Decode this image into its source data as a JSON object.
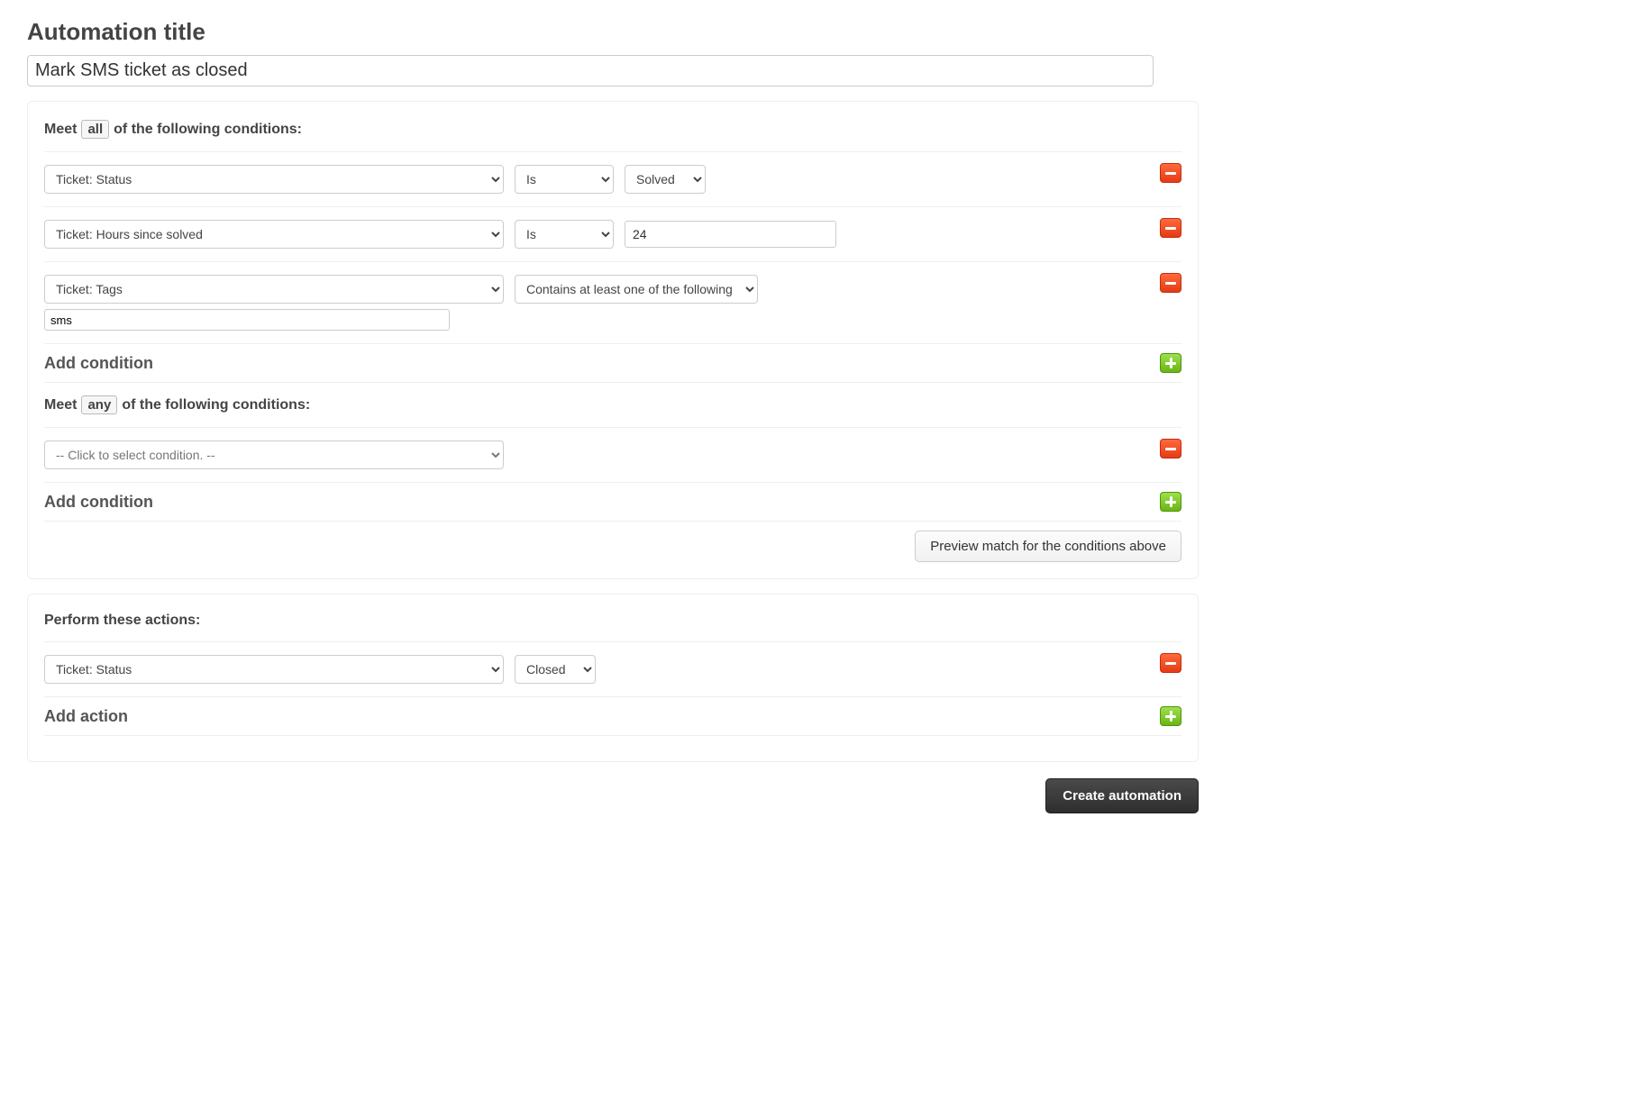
{
  "title_label": "Automation title",
  "title_value": "Mark SMS ticket as closed",
  "conditions": {
    "all": {
      "prefix": "Meet",
      "qualifier": "all",
      "suffix": "of the following conditions:",
      "rows": [
        {
          "field": "Ticket: Status",
          "operator": "Is",
          "value_select": "Solved"
        },
        {
          "field": "Ticket: Hours since solved",
          "operator": "Is",
          "value_text": "24"
        },
        {
          "field": "Ticket: Tags",
          "operator_wide": "Contains at least one of the following",
          "tags_value": "sms"
        }
      ],
      "add_label": "Add condition"
    },
    "any": {
      "prefix": "Meet",
      "qualifier": "any",
      "suffix": "of the following conditions:",
      "rows": [
        {
          "field_placeholder": "-- Click to select condition. --"
        }
      ],
      "add_label": "Add condition"
    },
    "preview_button": "Preview match for the conditions above"
  },
  "actions": {
    "heading": "Perform these actions:",
    "rows": [
      {
        "field": "Ticket: Status",
        "value_select": "Closed"
      }
    ],
    "add_label": "Add action"
  },
  "footer": {
    "create_button": "Create automation"
  }
}
